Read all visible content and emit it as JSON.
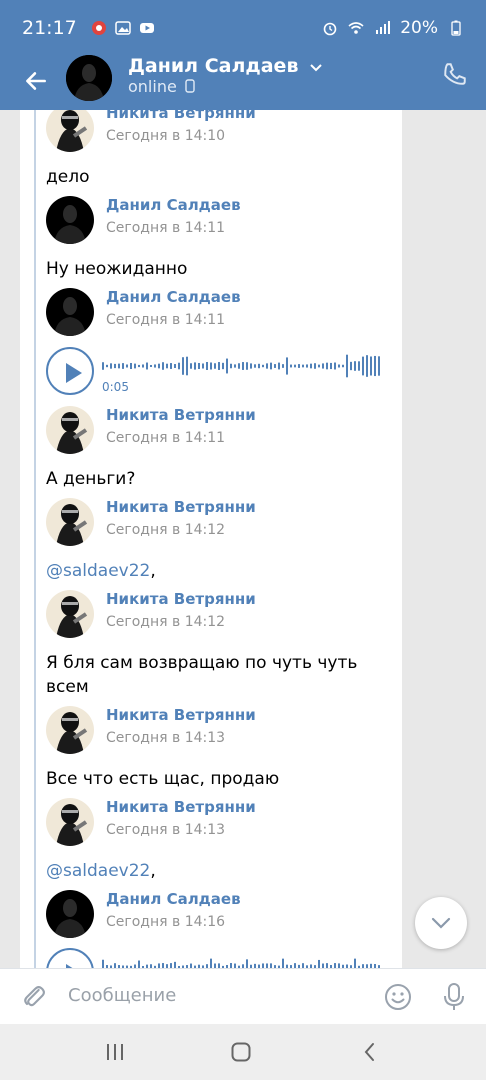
{
  "status_bar": {
    "time": "21:17",
    "battery": "20%"
  },
  "header": {
    "name": "Данил Салдаев",
    "status": "online"
  },
  "messages": [
    {
      "author": "Никита Ветрянни",
      "time": "Сегодня в 14:10",
      "text": "дело",
      "avatar": "nikita"
    },
    {
      "author": "Данил Салдаев",
      "time": "Сегодня в 14:11",
      "text": "Ну неожиданно",
      "avatar": "danil"
    },
    {
      "author": "Данил Салдаев",
      "time": "Сегодня в 14:11",
      "voice_duration": "0:05",
      "avatar": "danil"
    },
    {
      "author": "Никита Ветрянни",
      "time": "Сегодня в 14:11",
      "text": "А деньги?",
      "avatar": "nikita"
    },
    {
      "author": "Никита Ветрянни",
      "time": "Сегодня в 14:12",
      "mention": "@saldaev22",
      "suffix": ",",
      "avatar": "nikita"
    },
    {
      "author": "Никита Ветрянни",
      "time": "Сегодня в 14:12",
      "text": "Я бля сам возвращаю по чуть чуть всем",
      "avatar": "nikita"
    },
    {
      "author": "Никита Ветрянни",
      "time": "Сегодня в 14:13",
      "text": "Все что есть щас, продаю",
      "avatar": "nikita"
    },
    {
      "author": "Никита Ветрянни",
      "time": "Сегодня в 14:13",
      "mention": "@saldaev22",
      "suffix": ",",
      "avatar": "nikita"
    },
    {
      "author": "Данил Салдаев",
      "time": "Сегодня в 14:16",
      "avatar": "danil"
    }
  ],
  "composer": {
    "placeholder": "Сообщение"
  },
  "icons": {
    "back": "arrow-left-icon",
    "call": "phone-icon",
    "attach": "paperclip-icon",
    "emoji": "smile-icon",
    "mic": "microphone-icon",
    "scroll": "chevron-down-icon",
    "play": "play-icon",
    "nav_recent": "recent-apps-icon",
    "nav_home": "home-icon",
    "nav_back": "nav-back-icon"
  },
  "colors": {
    "accent": "#5181b8",
    "time_gray": "#939393",
    "bg": "#ffffff"
  }
}
